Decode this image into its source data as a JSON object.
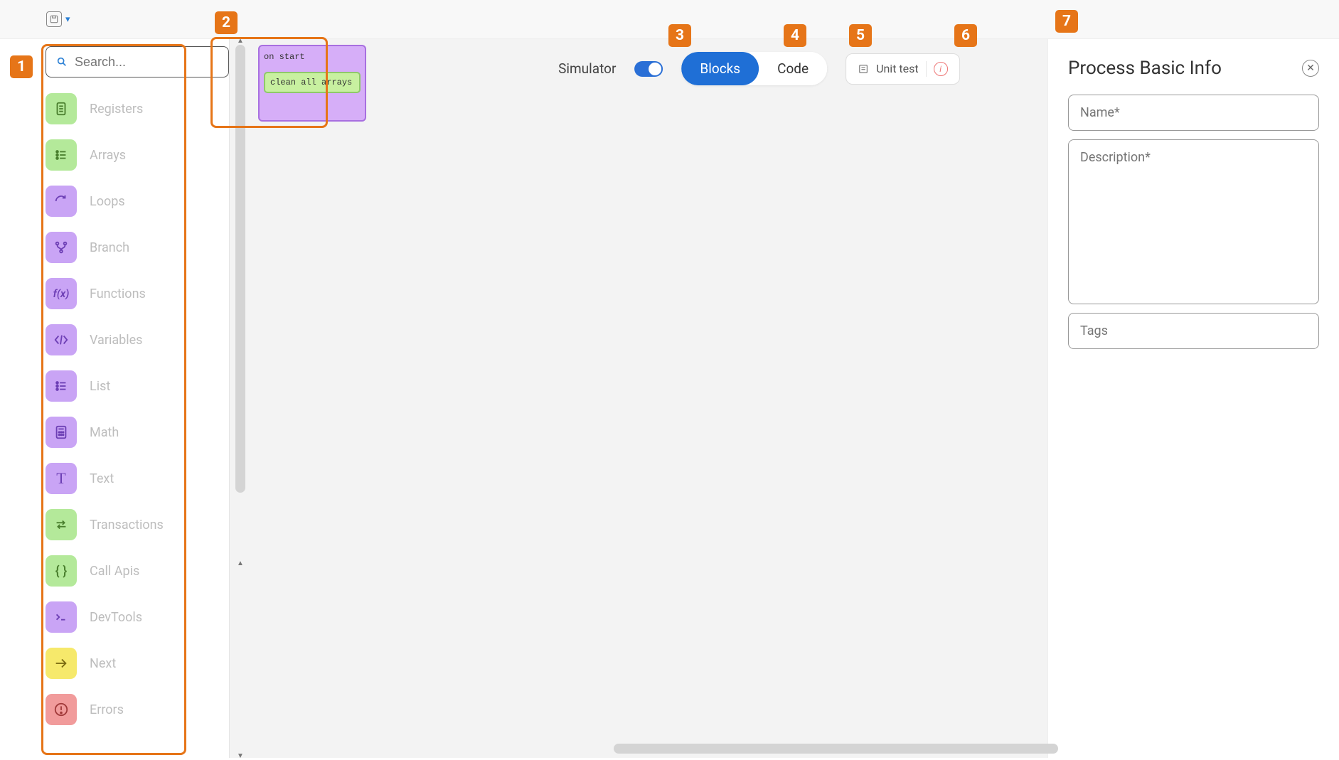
{
  "topbar": {
    "save_tooltip": "Save"
  },
  "sidebar": {
    "search_placeholder": "Search...",
    "categories": [
      {
        "label": "Registers",
        "color": "green",
        "icon": "file"
      },
      {
        "label": "Arrays",
        "color": "green",
        "icon": "list"
      },
      {
        "label": "Loops",
        "color": "purple",
        "icon": "refresh"
      },
      {
        "label": "Branch",
        "color": "purple",
        "icon": "branch"
      },
      {
        "label": "Functions",
        "color": "purple",
        "icon": "fx"
      },
      {
        "label": "Variables",
        "color": "purple",
        "icon": "code"
      },
      {
        "label": "List",
        "color": "purple",
        "icon": "list"
      },
      {
        "label": "Math",
        "color": "purple",
        "icon": "calc"
      },
      {
        "label": "Text",
        "color": "purple",
        "icon": "text"
      },
      {
        "label": "Transactions",
        "color": "green",
        "icon": "swap"
      },
      {
        "label": "Call Apis",
        "color": "green",
        "icon": "braces"
      },
      {
        "label": "DevTools",
        "color": "purple",
        "icon": "terminal"
      },
      {
        "label": "Next",
        "color": "yellow",
        "icon": "arrow"
      },
      {
        "label": "Errors",
        "color": "red",
        "icon": "alert"
      }
    ]
  },
  "canvas": {
    "block": {
      "outer_label": "on start",
      "inner_label": "clean all arrays"
    }
  },
  "controls": {
    "simulator_label": "Simulator",
    "simulator_on": true,
    "blocks_label": "Blocks",
    "code_label": "Code",
    "unit_test_label": "Unit test"
  },
  "rightpanel": {
    "title": "Process Basic Info",
    "name_placeholder": "Name*",
    "description_placeholder": "Description*",
    "tags_placeholder": "Tags"
  },
  "callouts": [
    "1",
    "2",
    "3",
    "4",
    "5",
    "6",
    "7"
  ]
}
